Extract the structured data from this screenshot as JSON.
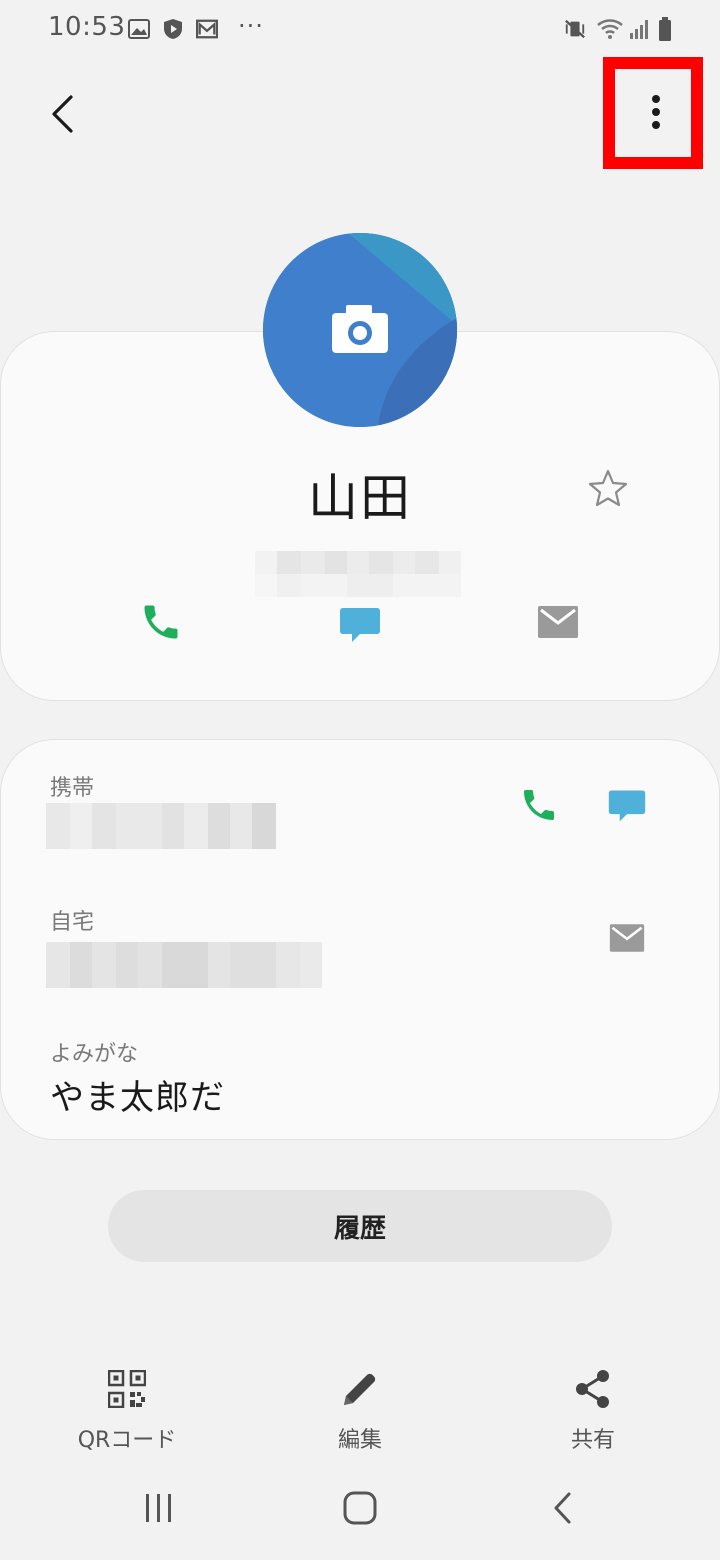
{
  "status_bar": {
    "time": "10:53",
    "overflow": "···",
    "left_icons": [
      "gallery-icon",
      "shield-play-icon",
      "mail-icon"
    ],
    "right_icons": [
      "vibrate-mute-icon",
      "wifi-icon",
      "signal-icon",
      "battery-icon"
    ]
  },
  "top_bar": {
    "back_icon": "back-arrow-icon",
    "more_icon": "more-vertical-icon",
    "highlight_color": "#ff0000"
  },
  "profile": {
    "avatar_icon": "camera-icon",
    "avatar_color": "#3f7fcc",
    "name": "山田",
    "favorite_icon": "star-outline-icon",
    "actions": [
      {
        "name": "call",
        "icon": "phone-icon",
        "color": "#1fae5b"
      },
      {
        "name": "message",
        "icon": "message-icon",
        "color": "#4fb0da"
      },
      {
        "name": "email",
        "icon": "mail-icon",
        "color": "#9a9a9a"
      }
    ]
  },
  "details": {
    "mobile_label": "携帯",
    "home_label": "自宅",
    "reading_label": "よみがな",
    "reading_value": "やま太郎だ"
  },
  "history_button": "履歴",
  "toolbar": {
    "qr_label": "QRコード",
    "edit_label": "編集",
    "share_label": "共有"
  },
  "nav": {
    "recents_icon": "recents-icon",
    "home_icon": "home-icon",
    "back_icon": "back-icon"
  },
  "colors": {
    "background": "#f2f2f2",
    "card": "#fafafa",
    "call_green": "#1fae5b",
    "message_blue": "#4fb0da",
    "mail_gray": "#9a9a9a"
  }
}
